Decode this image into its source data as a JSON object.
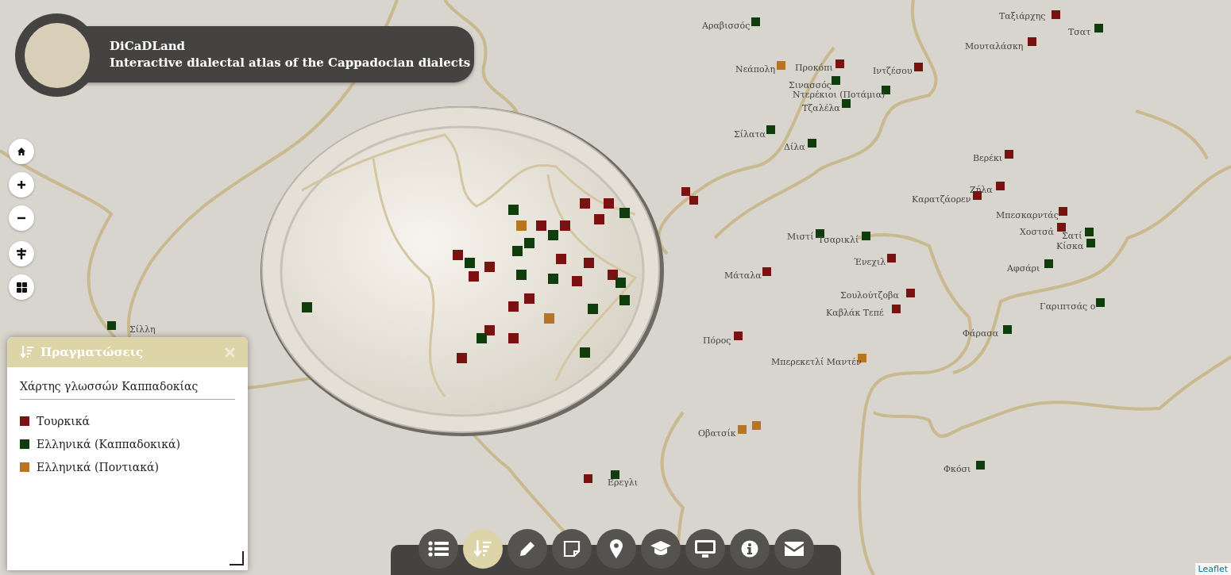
{
  "header": {
    "title": "DiCaDLand",
    "subtitle": "Interactive dialectal atlas of the Cappadocian dialects"
  },
  "markers": [
    {
      "name": "Αραβισσός",
      "color": "#0f3d0b"
    },
    {
      "name": "Νεάπολη",
      "color": "#b87423"
    },
    {
      "name": "Προκόπι",
      "color": "#7a1212"
    },
    {
      "name": "Ιντζέσου",
      "color": "#7a1212"
    },
    {
      "name": "Σινασσός",
      "color": "#0f3d0b"
    },
    {
      "name": "Ντερέκιοι (Ποτάμια)",
      "color": "#0f3d0b"
    },
    {
      "name": "Τζαλέλα",
      "color": "#0f3d0b"
    },
    {
      "name": "Σίλατα",
      "color": "#0f3d0b"
    },
    {
      "name": "Δίλα",
      "color": "#0f3d0b"
    },
    {
      "name": "Ταξιάρχης",
      "color": "#7a1212"
    },
    {
      "name": "Μουταλάσκη",
      "color": "#7a1212"
    },
    {
      "name": "Τσατ",
      "color": "#0f3d0b"
    },
    {
      "name": "Βερέκι",
      "color": "#7a1212"
    },
    {
      "name": "Ζήλα",
      "color": "#7a1212"
    },
    {
      "name": "Καρατζάορεν",
      "color": "#7a1212"
    },
    {
      "name": "Μπεσκαρντάς",
      "color": "#7a1212"
    },
    {
      "name": "Χοστσά",
      "color": "#7a1212"
    },
    {
      "name": "Σατί",
      "color": "#0f3d0b"
    },
    {
      "name": "Κίσκα",
      "color": "#0f3d0b"
    },
    {
      "name": "Αφσάρι",
      "color": "#0f3d0b"
    },
    {
      "name": "Γαριπτσάς ο",
      "color": "#0f3d0b"
    },
    {
      "name": "Φάρασα",
      "color": "#0f3d0b"
    },
    {
      "name": "Φκόσι",
      "color": "#0f3d0b"
    },
    {
      "name": "Μιστί",
      "color": "#0f3d0b"
    },
    {
      "name": "Τσαρικλί",
      "color": "#0f3d0b"
    },
    {
      "name": "Ένεχιλ",
      "color": "#7a1212"
    },
    {
      "name": "Μάταλα",
      "color": "#7a1212"
    },
    {
      "name": "Σουλούτζοβα",
      "color": "#7a1212"
    },
    {
      "name": "Καβλάκ Τεπέ",
      "color": "#7a1212"
    },
    {
      "name": "Πόρος",
      "color": "#7a1212"
    },
    {
      "name": "Μπερεκετλί Μαντέν",
      "color": "#b87423"
    },
    {
      "name": "Οβατσίκ",
      "color": "#b87423"
    },
    {
      "name": "Ερεγλι",
      "color": "#0f3d0b"
    },
    {
      "name": "Σίλλη",
      "color": "#0f3d0b"
    },
    {
      "color": "#7a1212"
    },
    {
      "color": "#7a1212"
    },
    {
      "color": "#b87423"
    },
    {
      "color": "#7a1212"
    }
  ],
  "legend": {
    "title": "Πραγματώσεις",
    "subtitle": "Χάρτης γλωσσών Καππαδοκίας",
    "items": [
      {
        "label": "Τουρκικά",
        "color": "#7a1212"
      },
      {
        "label": "Ελληνικά (Καππαδοκικά)",
        "color": "#0f3d0b"
      },
      {
        "label": "Ελληνικά (Ποντιακά)",
        "color": "#b87423"
      }
    ]
  },
  "toolbar": [
    {
      "kind": "list",
      "selected": false
    },
    {
      "kind": "legend",
      "selected": true
    },
    {
      "kind": "edit",
      "selected": false
    },
    {
      "kind": "note",
      "selected": false
    },
    {
      "kind": "pin",
      "selected": false
    },
    {
      "kind": "learn",
      "selected": false
    },
    {
      "kind": "screen",
      "selected": false
    },
    {
      "kind": "info",
      "selected": false
    },
    {
      "kind": "mail",
      "selected": false
    }
  ],
  "attribution": "Leaflet"
}
